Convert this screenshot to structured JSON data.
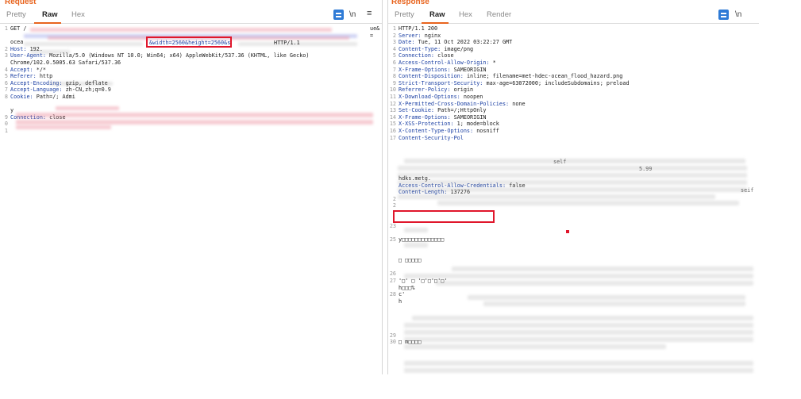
{
  "request": {
    "title": "Request",
    "tabs": [
      "Pretty",
      "Raw",
      "Hex"
    ],
    "active_tab": "Raw",
    "tools": {
      "newline_label": "\\n",
      "menu_label": "≡"
    },
    "lines": [
      {
        "n": "1",
        "name": "",
        "value": "GET /"
      },
      {
        "n": "",
        "name": "",
        "value": ""
      },
      {
        "n": "",
        "name": "",
        "value": "ocea"
      },
      {
        "n": "2",
        "name": "Host: ",
        "value": "192."
      },
      {
        "n": "3",
        "name": "User-Agent: ",
        "value": "Mozilla/5.0 (Windows NT 10.0; Win64; x64) AppleWebKit/537.36 (KHTML, like Gecko)"
      },
      {
        "n": "",
        "name": "",
        "value": "Chrome/102.0.5005.63 Safari/537.36"
      },
      {
        "n": "4",
        "name": "Accept: ",
        "value": "*/*"
      },
      {
        "n": "5",
        "name": "Referer: ",
        "value": "http"
      },
      {
        "n": "6",
        "name": "Accept-Encoding: ",
        "value": "gzip, deflate"
      },
      {
        "n": "7",
        "name": "Accept-Language: ",
        "value": "zh-CN,zh;q=0.9"
      },
      {
        "n": "8",
        "name": "Cookie: ",
        "value": "Path=/; Admi"
      },
      {
        "n": "",
        "name": "",
        "value": ""
      },
      {
        "n": "",
        "name": "",
        "value": "y"
      },
      {
        "n": "9",
        "name": "Connection: ",
        "value": "close"
      },
      {
        "n": "0",
        "name": "",
        "value": ""
      },
      {
        "n": "1",
        "name": "",
        "value": ""
      }
    ],
    "highlight": {
      "width_label": "&width=2560",
      "height_label": "&height=2560",
      "trail": "&s",
      "version": "HTTP/1.1",
      "tail1": "ue&",
      "tail2": "="
    }
  },
  "response": {
    "title": "Response",
    "tabs": [
      "Pretty",
      "Raw",
      "Hex",
      "Render"
    ],
    "active_tab": "Raw",
    "tools": {
      "newline_label": "\\n"
    },
    "lines": [
      {
        "n": "1",
        "name": "",
        "value": "HTTP/1.1 200"
      },
      {
        "n": "2",
        "name": "Server: ",
        "value": "nginx"
      },
      {
        "n": "3",
        "name": "Date: ",
        "value": "Tue, 11 Oct 2022 03:22:27 GMT"
      },
      {
        "n": "4",
        "name": "Content-Type: ",
        "value": "image/png"
      },
      {
        "n": "5",
        "name": "Connection: ",
        "value": "close"
      },
      {
        "n": "6",
        "name": "Access-Control-Allow-Origin: ",
        "value": "*"
      },
      {
        "n": "7",
        "name": "X-Frame-Options: ",
        "value": "SAMEORIGIN"
      },
      {
        "n": "8",
        "name": "Content-Disposition: ",
        "value": "inline; filename=met-hdec-ocean_flood_hazard.png"
      },
      {
        "n": "9",
        "name": "Strict-Transport-Security: ",
        "value": "max-age=63072000; includeSubdomains; preload"
      },
      {
        "n": "10",
        "name": "Referrer-Policy: ",
        "value": "origin"
      },
      {
        "n": "11",
        "name": "X-Download-Options: ",
        "value": "noopen"
      },
      {
        "n": "12",
        "name": "X-Permitted-Cross-Domain-Policies: ",
        "value": "none"
      },
      {
        "n": "13",
        "name": "Set-Cookie: ",
        "value": "Path=/;HttpOnly"
      },
      {
        "n": "14",
        "name": "X-Frame-Options: ",
        "value": "SAMEORIGIN"
      },
      {
        "n": "15",
        "name": "X-XSS-Protection: ",
        "value": "1; mode=block"
      },
      {
        "n": "16",
        "name": "X-Content-Type-Options: ",
        "value": "nosniff"
      },
      {
        "n": "17",
        "name": "Content-Security-Pol",
        "value": ""
      },
      {
        "n": "",
        "name": "",
        "value": ""
      },
      {
        "n": "",
        "name": "",
        "value": ""
      },
      {
        "n": "",
        "name": "",
        "value": ""
      },
      {
        "n": "",
        "name": "",
        "value": ""
      },
      {
        "n": "",
        "name": "",
        "value": ""
      },
      {
        "n": "",
        "name": "",
        "value": "hdks.metg."
      },
      {
        "n": "",
        "name": "Access-Control-Allow-Credentials: ",
        "value": "false"
      },
      {
        "n": "",
        "name": "Content-Length: ",
        "value": "137276"
      },
      {
        "n": "2",
        "name": "",
        "value": ""
      },
      {
        "n": "2",
        "name": "",
        "value": ""
      },
      {
        "n": "",
        "name": "",
        "value": ""
      },
      {
        "n": "",
        "name": "",
        "value": ""
      },
      {
        "n": "23",
        "name": "",
        "value": ""
      },
      {
        "n": "",
        "name": "",
        "value": ""
      },
      {
        "n": "25",
        "name": "",
        "value": "y□□□□□□□□□□□□□"
      },
      {
        "n": "",
        "name": "",
        "value": ""
      },
      {
        "n": "",
        "name": "",
        "value": ""
      },
      {
        "n": "",
        "name": "",
        "value": "□ □□□□□"
      },
      {
        "n": "",
        "name": "",
        "value": ""
      },
      {
        "n": "26",
        "name": "",
        "value": ""
      },
      {
        "n": "27",
        "name": "",
        "value": "'□'   □   '□'□'□'□'"
      },
      {
        "n": "",
        "name": "",
        "value": "h□□□%"
      },
      {
        "n": "28",
        "name": "",
        "value": "c'"
      },
      {
        "n": "",
        "name": "",
        "value": "h"
      },
      {
        "n": "",
        "name": "",
        "value": ""
      },
      {
        "n": "",
        "name": "",
        "value": ""
      },
      {
        "n": "",
        "name": "",
        "value": ""
      },
      {
        "n": "",
        "name": "",
        "value": ""
      },
      {
        "n": "29",
        "name": "",
        "value": ""
      },
      {
        "n": "30",
        "name": "",
        "value": "□         m□□□□"
      }
    ],
    "csp_fragments": {
      "frag1": "self",
      "frag2": "5.99",
      "frag3": "seif"
    }
  }
}
